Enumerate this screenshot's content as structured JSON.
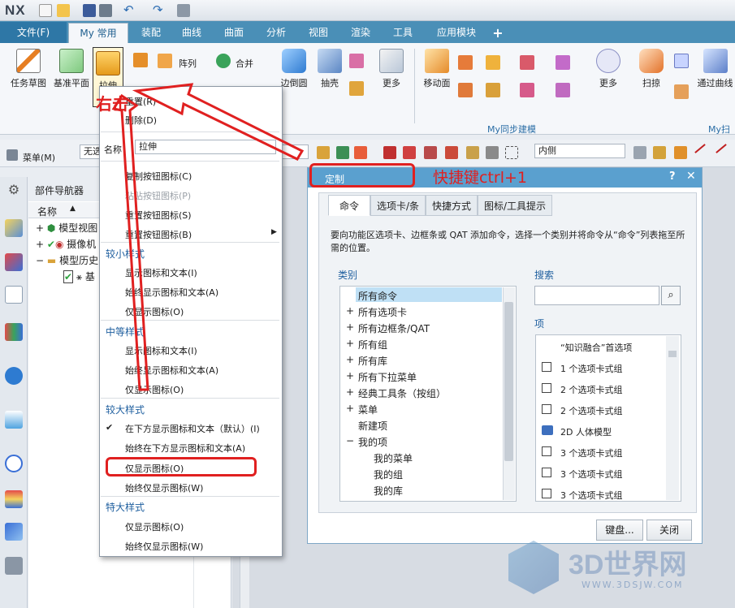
{
  "titlebar": {
    "logo": "NX"
  },
  "menu_tabs": {
    "file": "文件(F)",
    "items": [
      "My 常用",
      "装配",
      "曲线",
      "曲面",
      "分析",
      "视图",
      "渲染",
      "工具",
      "应用模块"
    ]
  },
  "ribbon": {
    "buttons": [
      "任务草图",
      "基准平面",
      "拉伸"
    ],
    "small": [
      "阵列",
      "合并"
    ],
    "right_buttons": [
      "边倒圆",
      "抽壳",
      "更多",
      "移动面",
      "更多",
      "扫掠",
      "通过曲线"
    ],
    "groups": [
      "My同步建模",
      "My扫"
    ]
  },
  "toolbar2": {
    "menu_label": "菜单(M)",
    "filter_value": "无选",
    "name_label": "名称",
    "name_value": "拉伸",
    "snap_value": "内侧"
  },
  "nav": {
    "title": "部件导航器",
    "col_name": "名称",
    "tree": [
      "模型视图",
      "摄像机",
      "模型历史",
      "基"
    ]
  },
  "context_menu": {
    "top_items": [
      "重置(R)",
      "删除(D)"
    ],
    "mid_items": [
      "复制按钮图标(C)",
      "粘贴按钮图标(P)",
      "重置按钮图标(S)",
      "重置按钮图标(B)"
    ],
    "sections": [
      {
        "title": "较小样式",
        "items": [
          "显示图标和文本(I)",
          "始终显示图标和文本(A)",
          "仅显示图标(O)"
        ]
      },
      {
        "title": "中等样式",
        "items": [
          "显示图标和文本(I)",
          "始终显示图标和文本(A)",
          "仅显示图标(O)"
        ]
      },
      {
        "title": "较大样式",
        "items": [
          "在下方显示图标和文本（默认）(I)",
          "始终在下方显示图标和文本(A)",
          "仅显示图标(O)",
          "始终仅显示图标(W)"
        ]
      },
      {
        "title": "特大样式",
        "items": [
          "仅显示图标(O)",
          "始终仅显示图标(W)"
        ]
      }
    ]
  },
  "dialog": {
    "title": "定制",
    "help": "?",
    "close": "✕",
    "tabs": [
      "命令",
      "选项卡/条",
      "快捷方式",
      "图标/工具提示"
    ],
    "description": "要向功能区选项卡、边框条或 QAT 添加命令，选择一个类别并将命令从“命令”列表拖至所需的位置。",
    "category_label": "类别",
    "categories": [
      "所有命令",
      "所有选项卡",
      "所有边框条/QAT",
      "所有组",
      "所有库",
      "所有下拉菜单",
      "经典工具条（按组）",
      "菜单",
      "新建项",
      "我的项",
      "我的菜单",
      "我的组",
      "我的库"
    ],
    "search_label": "搜索",
    "items_label": "项",
    "items": [
      "“知识融合”首选项",
      "1 个选项卡式组",
      "2 个选项卡式组",
      "2 个选项卡式组",
      "2D 人体模型",
      "3 个选项卡式组",
      "3 个选项卡式组",
      "3 个选项卡式组"
    ],
    "keyboard_button": "键盘...",
    "close_button": "关闭"
  },
  "annotations": {
    "right_click": "右击",
    "shortcut": "快捷键ctrl+1"
  },
  "watermark": {
    "text": "3D世界网",
    "url": "WWW.3DSJW.COM"
  }
}
